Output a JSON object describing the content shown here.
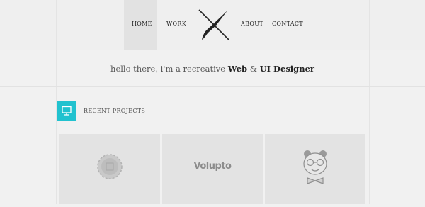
{
  "nav": {
    "home": "HOME",
    "work": "WORK",
    "about": "ABOUT",
    "contact": "CONTACT"
  },
  "logo": {
    "icon": "paintbrush-crossed-icon"
  },
  "tagline": {
    "prefix": "hello there, i'm a ",
    "struck": "re",
    "middle": "creative ",
    "bold1": "Web",
    "amp": " & ",
    "bold2": "UI Designer"
  },
  "section": {
    "title": "RECENT PROJECTS",
    "icon": "monitor-icon",
    "accent_color": "#21c2cf"
  },
  "projects": [
    {
      "logo_icon": "badge-seal-icon"
    },
    {
      "logo_text": "Volupto"
    },
    {
      "logo_icon": "panda-bowtie-icon"
    }
  ]
}
